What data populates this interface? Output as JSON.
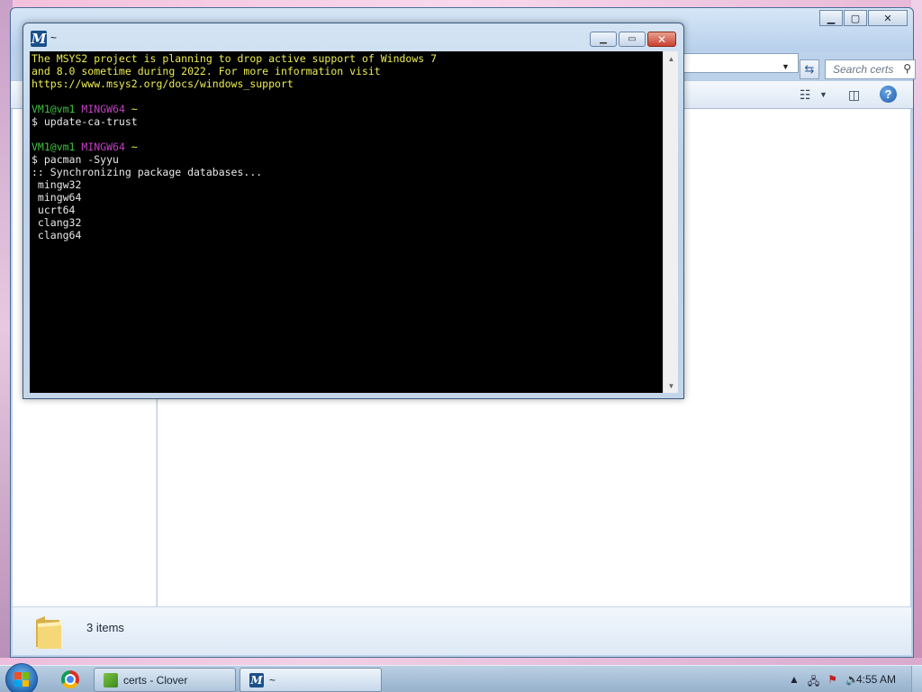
{
  "explorer": {
    "title": "certs",
    "search_placeholder": "Search certs",
    "items_count": "3 items",
    "help_label": "?"
  },
  "terminal": {
    "title": "~",
    "logo_letter": "M",
    "lines": [
      {
        "text": "The MSYS2 project is planning to drop active support of Windows 7",
        "color": "#ecec50"
      },
      {
        "text": "and 8.0 sometime during 2022. For more information visit",
        "color": "#ecec50"
      },
      {
        "text": "https://www.msys2.org/docs/windows_support",
        "color": "#ecec50"
      },
      {
        "text": "",
        "color": "#e8e8e8"
      },
      {
        "prompt_user": "VM1@vm1",
        "prompt_env": "MINGW64",
        "prompt_dir": "~"
      },
      {
        "text": "$ update-ca-trust",
        "color": "#e8e8e8"
      },
      {
        "text": "",
        "color": "#e8e8e8"
      },
      {
        "prompt_user": "VM1@vm1",
        "prompt_env": "MINGW64",
        "prompt_dir": "~"
      },
      {
        "text": "$ pacman -Syyu",
        "color": "#e8e8e8"
      },
      {
        "text": ":: Synchronizing package databases...",
        "color": "#e8e8e8"
      },
      {
        "text": " mingw32",
        "color": "#e8e8e8"
      },
      {
        "text": " mingw64",
        "color": "#e8e8e8"
      },
      {
        "text": " ucrt64",
        "color": "#e8e8e8"
      },
      {
        "text": " clang32",
        "color": "#e8e8e8"
      },
      {
        "text": " clang64",
        "color": "#e8e8e8"
      }
    ]
  },
  "taskbar": {
    "items": [
      {
        "label": "certs - Clover",
        "icon": "clover-icon"
      },
      {
        "label": "~",
        "icon": "msys2-icon"
      }
    ],
    "clock": "4:55 AM"
  },
  "colors": {
    "accent": "#1a4f8a",
    "prompt_green": "#40c040",
    "prompt_magenta": "#c040c0",
    "notice_yellow": "#ecec50"
  }
}
